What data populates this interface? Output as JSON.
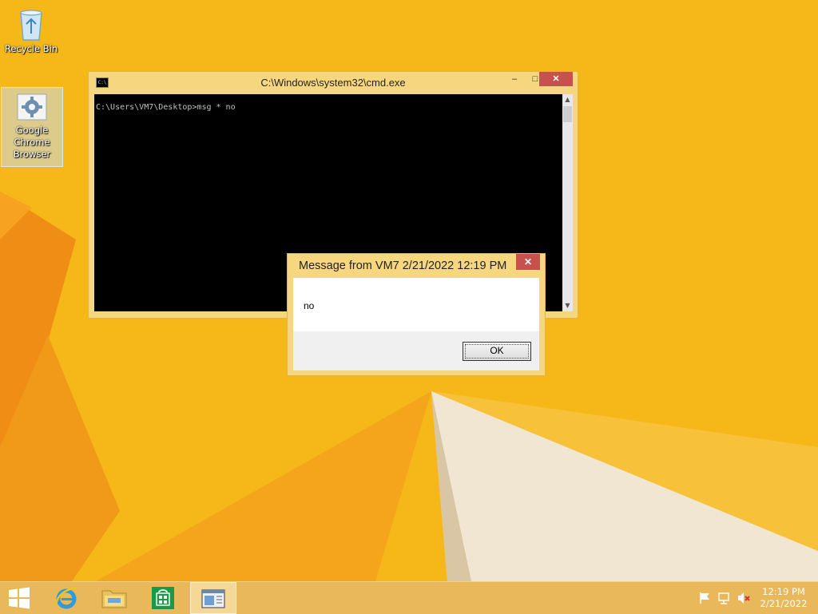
{
  "desktop": {
    "icons": [
      {
        "label": "Recycle Bin",
        "icon": "recycle-bin-icon"
      },
      {
        "label": "Google Chrome Browser",
        "icon": "settings-gear-icon"
      }
    ]
  },
  "cmd": {
    "title": "C:\\Windows\\system32\\cmd.exe",
    "console_line": "C:\\Users\\VM7\\Desktop>msg * no",
    "minimize": "–",
    "maximize": "□",
    "close": "✕"
  },
  "message_box": {
    "title": "Message from VM7 2/21/2022 12:19 PM",
    "text": "no",
    "ok_label": "OK",
    "close": "✕"
  },
  "taskbar": {
    "items": [
      "start-button",
      "internet-explorer",
      "file-explorer",
      "store",
      "cmd-window"
    ],
    "clock_time": "12:19 PM",
    "clock_date": "2/21/2022"
  },
  "colors": {
    "wallpaper": "#f6b718",
    "window_frame": "#f6d77f",
    "close_button": "#c7514d",
    "taskbar": "#e8b85a"
  }
}
